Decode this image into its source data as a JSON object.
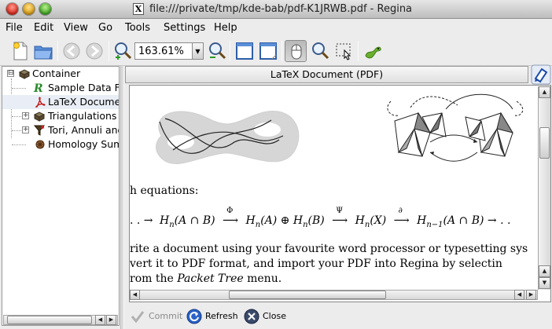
{
  "window": {
    "title": "file:///private/tmp/kde-bab/pdf-K1JRWB.pdf - Regina",
    "title_icon": "X"
  },
  "menu": [
    "File",
    "Edit",
    "View",
    "Go",
    "Tools",
    "Settings",
    "Help"
  ],
  "toolbar": {
    "zoom_value": "163.61%",
    "zoom_drop_glyph": "▼"
  },
  "tree": {
    "items": [
      {
        "label": "Container",
        "icon": "container-icon",
        "expander": "⊟"
      },
      {
        "label": "Sample Data F",
        "icon": "script-icon"
      },
      {
        "label": "LaTeX Docume",
        "icon": "pdf-icon"
      },
      {
        "label": "Triangulations",
        "icon": "container-icon",
        "expander": "+"
      },
      {
        "label": "Tori, Annuli and",
        "icon": "filter-icon",
        "expander": "+"
      },
      {
        "label": "Homology Sum",
        "icon": "surfaces-icon"
      }
    ]
  },
  "packet": {
    "title": "LaTeX Document (PDF)"
  },
  "pdf": {
    "line_equations": "h equations:",
    "seq": {
      "start": ". . →",
      "hn1": "H",
      "sub": "n",
      "t1": "(A ∩ B)",
      "arrow1_label": "Φ",
      "t2": "(A) ⊕",
      "t3": "(B)",
      "arrow2_label": "Ψ",
      "t4": "(X)",
      "arrow3_label": "∂",
      "sub2": "n−1",
      "t5": "(A ∩ B) → . ."
    },
    "para1": "rite a document using your favourite word processor or typesetting sys",
    "para2": "vert it to PDF format, and import your PDF into Regina by selectin",
    "para3_pre": "rom the ",
    "para3_em": "Packet Tree",
    "para3_post": " menu."
  },
  "scroll": {
    "left": "◀",
    "right": "▶",
    "up": "▲",
    "down": "▼"
  },
  "actions": {
    "commit": "Commit",
    "refresh": "Refresh",
    "close": "Close"
  }
}
